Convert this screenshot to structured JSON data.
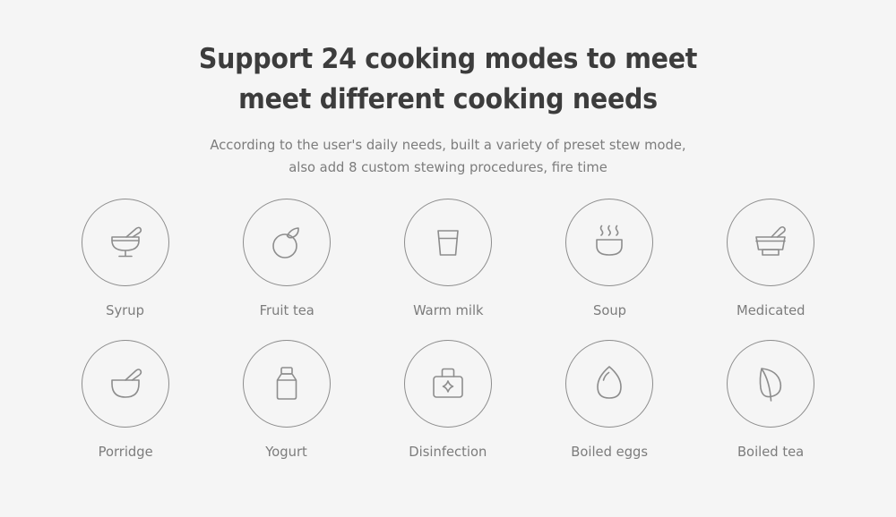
{
  "header": {
    "headline_line1": "Support 24 cooking modes to meet",
    "headline_line2": "meet different cooking needs",
    "subtitle_line1": "According to the user's daily needs, built a variety of preset stew mode,",
    "subtitle_line2": "also add 8 custom stewing procedures, fire time"
  },
  "colors": {
    "background": "#f5f5f5",
    "headline": "#3c3c3c",
    "subtitle": "#7c7c7c",
    "icon_stroke": "#8d8d8d",
    "label": "#7c7c7c"
  },
  "modes": {
    "rows": [
      [
        {
          "label": "Syrup",
          "icon": "mortar-pestle-stand-icon"
        },
        {
          "label": "Fruit tea",
          "icon": "fruit-leaf-icon"
        },
        {
          "label": "Warm milk",
          "icon": "milk-glass-icon"
        },
        {
          "label": "Soup",
          "icon": "soup-bowl-steam-icon"
        },
        {
          "label": "Medicated",
          "icon": "mortar-pestle-base-icon"
        }
      ],
      [
        {
          "label": "Porridge",
          "icon": "bowl-pestle-icon"
        },
        {
          "label": "Yogurt",
          "icon": "yogurt-jar-icon"
        },
        {
          "label": "Disinfection",
          "icon": "first-aid-kit-icon"
        },
        {
          "label": "Boiled eggs",
          "icon": "egg-icon"
        },
        {
          "label": "Boiled tea",
          "icon": "tea-leaf-icon"
        }
      ]
    ]
  }
}
